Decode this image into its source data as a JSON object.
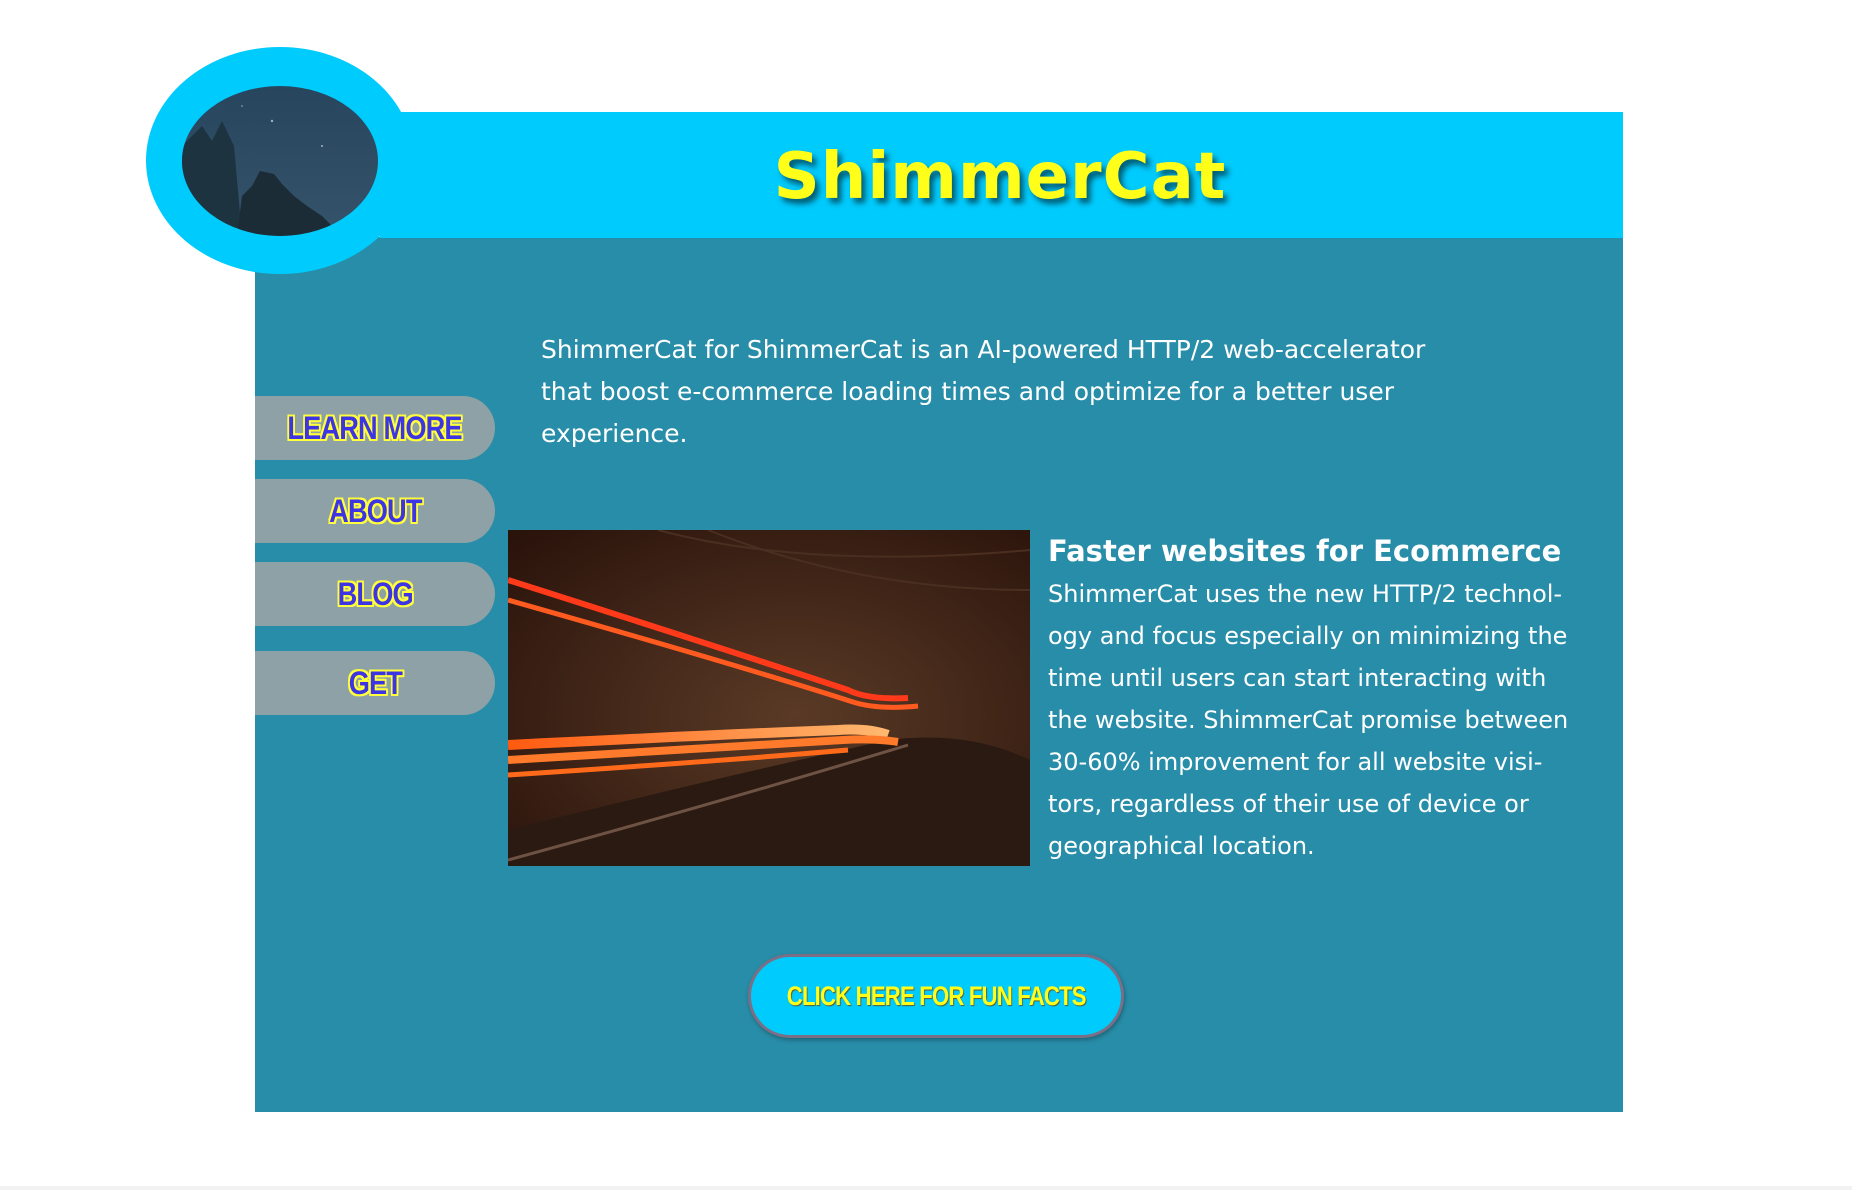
{
  "site": {
    "title": "ShimmerCat",
    "intro": "ShimmerCat for ShimmerCat is an AI-powered HTTP/2 web-accelerator that boost e-commerce loading times and optimize for a better user experience."
  },
  "nav": {
    "items": [
      {
        "label": "LEARN MORE"
      },
      {
        "label": "ABOUT"
      },
      {
        "label": "BLOG"
      },
      {
        "label": "GET"
      }
    ]
  },
  "feature": {
    "heading": "Faster websites for Ecommerce",
    "body": "ShimmerCat uses the new HTTP/2 technol- ogy and focus especially on minimizing the time until users can start interacting with the website. ShimmerCat promise between 30-60% improvement for all website visi- tors, regardless of their use of device or geographical location."
  },
  "cta": {
    "label": "CLICK HERE FOR FUN FACTS"
  },
  "colors": {
    "header": "#00cbfd",
    "panel": "#288da8",
    "title": "#ffff19",
    "nav_button": "#8ea1a6",
    "nav_text": "#3d34e4"
  }
}
